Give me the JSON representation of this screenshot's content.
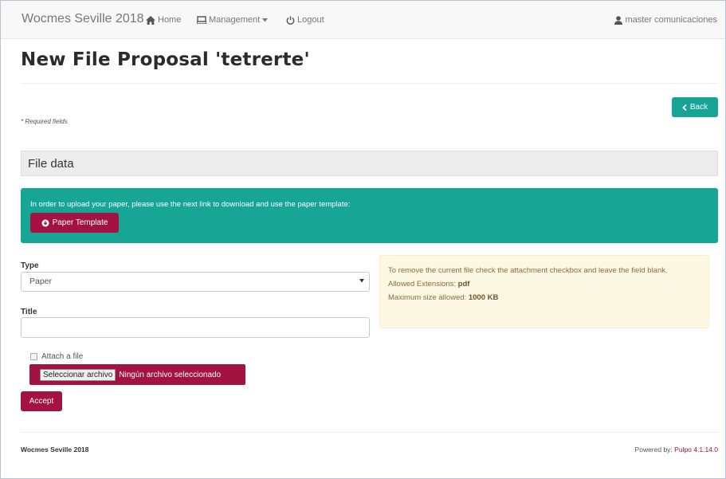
{
  "navbar": {
    "brand": "Wocmes Seville 2018",
    "home": "Home",
    "management": "Management",
    "logout": "Logout",
    "user": "master comunicaciones"
  },
  "page": {
    "title": "New File Proposal 'tetrerte'",
    "back_label": "Back",
    "required_note": "* Required fields"
  },
  "panel": {
    "heading": "File data"
  },
  "template_alert": {
    "text": "In order to upload your paper, please use the next link to download and use the paper template:",
    "button_label": "Paper Template"
  },
  "form": {
    "type_label": "Type",
    "type_value": "Paper",
    "title_label": "Title",
    "title_value": "",
    "attach_label": "Attach a file",
    "file_button": "Seleccionar archivo",
    "file_status": "Ningún archivo seleccionado",
    "accept_label": "Accept"
  },
  "info_alert": {
    "remove_note": "To remove the current file check the attachment checkbox and leave the field blank.",
    "extensions_label": "Allowed Extensions:",
    "extensions_value": "pdf",
    "max_size_label": "Maximum size allowed:",
    "max_size_value": "1000 KB"
  },
  "footer": {
    "left": "Wocmes Seville 2018",
    "powered_by": "Powered by:",
    "product": "Pulpo 4.1.14.0"
  },
  "colors": {
    "accent_teal": "#16a496",
    "accent_crimson": "#a31240",
    "warning_bg": "#fcf8e3"
  },
  "icons": [
    "home-icon",
    "hdd-icon",
    "caret-down-icon",
    "power-icon",
    "user-icon",
    "chevron-left-icon",
    "circle-arrow-down-icon"
  ]
}
